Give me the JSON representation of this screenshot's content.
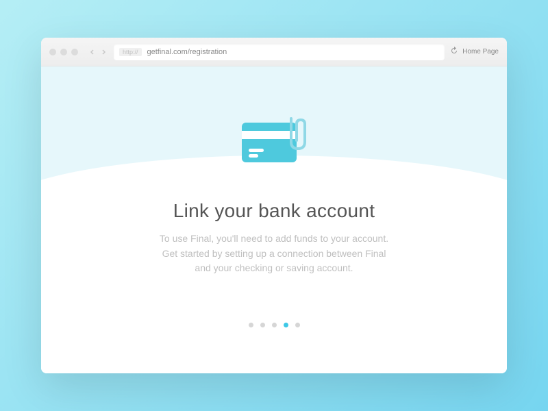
{
  "browser": {
    "protocol": "http://",
    "url": "getfinal.com/registration",
    "home_label": "Home Page"
  },
  "page": {
    "heading": "Link your bank account",
    "description_l1": "To use Final, you'll need to add funds to your account.",
    "description_l2": "Get started by setting up a connection between Final",
    "description_l3": "and your checking or saving account."
  },
  "pagination": {
    "total": 5,
    "active_index": 3
  },
  "colors": {
    "accent": "#3dc8e6",
    "card_fill": "#4ec9dd",
    "background_light": "#e6f7fb"
  }
}
